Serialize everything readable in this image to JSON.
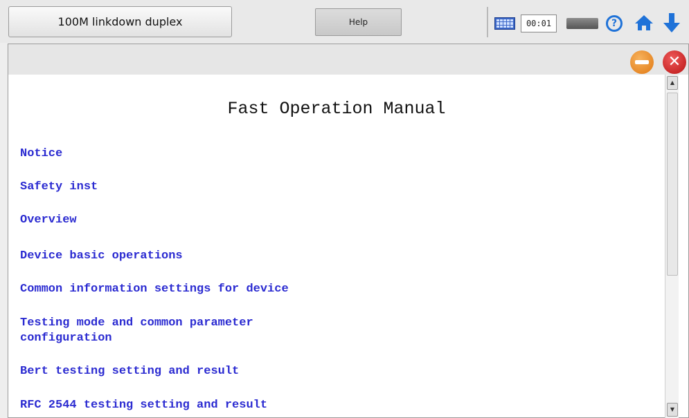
{
  "topbar": {
    "status_label": "100M linkdown duplex",
    "help_label": "Help",
    "timer": "00:01",
    "icons": [
      "keyboard-icon",
      "battery-icon",
      "help-circle-icon",
      "home-icon",
      "down-arrow-icon"
    ],
    "accent_color": "#1f72d8"
  },
  "panel": {
    "header_icons": [
      "minimize-icon",
      "close-icon"
    ],
    "title": "Fast Operation Manual",
    "link_color": "#2b2bd1",
    "links": [
      "Notice",
      "Safety inst",
      "Overview",
      "Device basic operations",
      "Common information settings for device",
      "Testing mode and common parameter",
      "configuration",
      "Bert testing setting and result",
      "RFC 2544 testing setting and result"
    ]
  }
}
